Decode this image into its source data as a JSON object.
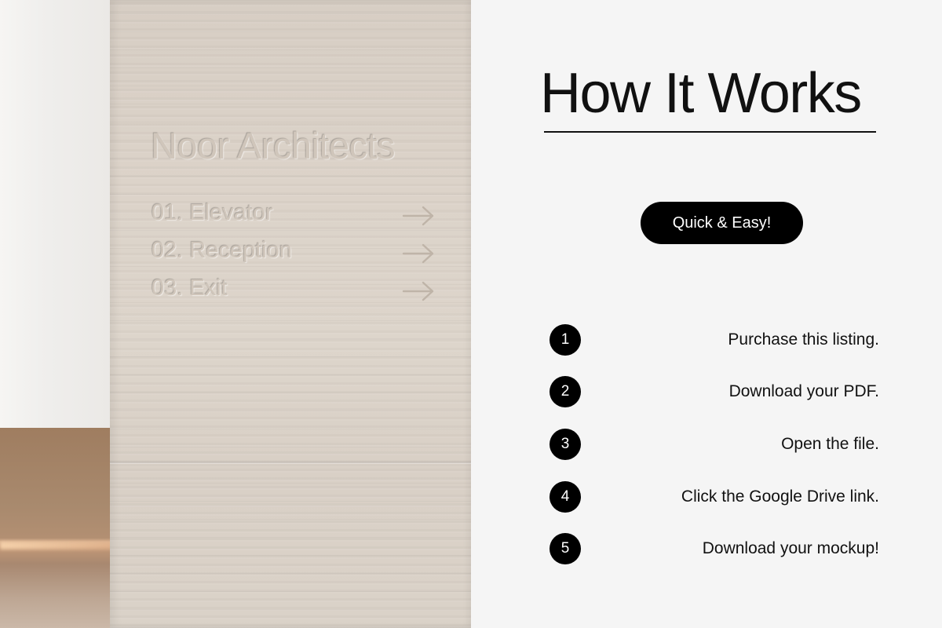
{
  "photo": {
    "sign_title": "Noor Architects",
    "rows": [
      {
        "label": "01. Elevator",
        "icon": "arrow-right-icon"
      },
      {
        "label": "02. Reception",
        "icon": "arrow-right-icon"
      },
      {
        "label": "03. Exit",
        "icon": "arrow-right-icon"
      }
    ]
  },
  "panel": {
    "title": "How It Works",
    "badge": "Quick & Easy!",
    "steps": [
      {
        "number": "1",
        "text": "Purchase this listing."
      },
      {
        "number": "2",
        "text": "Download your PDF."
      },
      {
        "number": "3",
        "text": "Open the file."
      },
      {
        "number": "4",
        "text": "Click the Google Drive link."
      },
      {
        "number": "5",
        "text": "Download your mockup!"
      }
    ]
  },
  "colors": {
    "panel_background": "#f5f5f5",
    "text": "#111111",
    "badge_background": "#000000",
    "badge_text": "#ffffff",
    "stone": "#dcd3c9"
  }
}
